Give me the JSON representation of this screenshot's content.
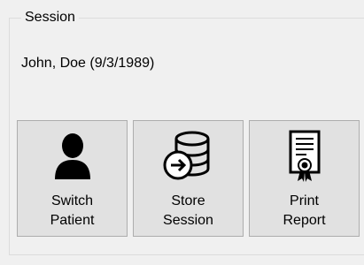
{
  "session": {
    "title": "Session",
    "patient_label": "John, Doe (9/3/1989)"
  },
  "buttons": {
    "switch_patient": {
      "line1": "Switch",
      "line2": "Patient",
      "icon": "person-icon"
    },
    "store_session": {
      "line1": "Store",
      "line2": "Session",
      "icon": "database-arrow-icon"
    },
    "print_report": {
      "line1": "Print",
      "line2": "Report",
      "icon": "certificate-icon"
    }
  }
}
